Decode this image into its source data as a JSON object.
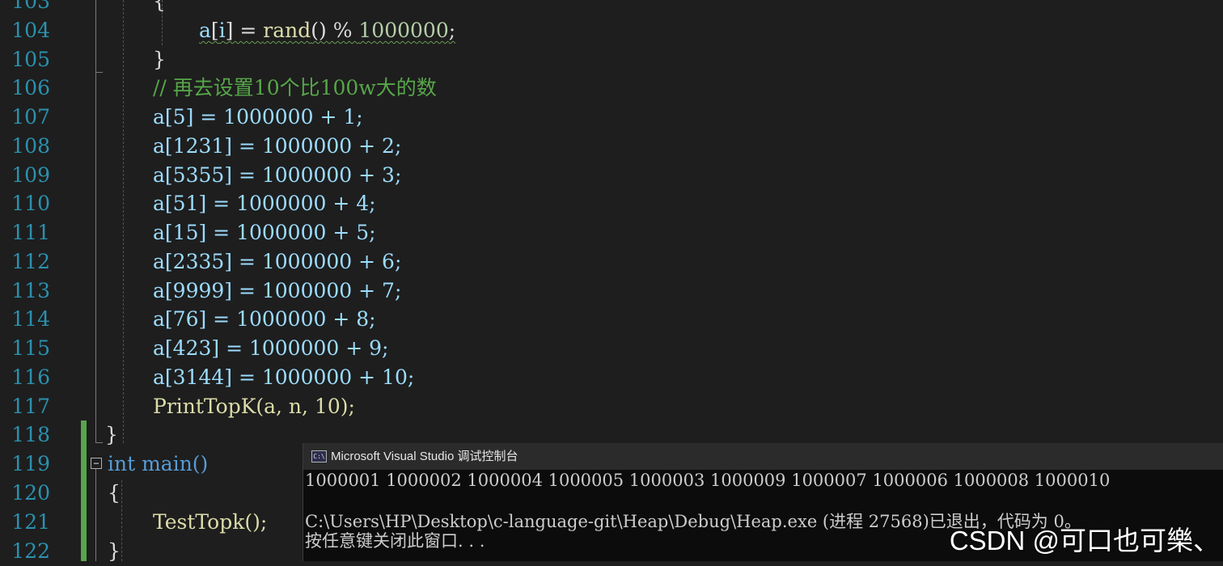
{
  "editor": {
    "lines": [
      {
        "num": "103",
        "text": "{"
      },
      {
        "num": "104",
        "text": "a[i] = rand() % 1000000;"
      },
      {
        "num": "105",
        "text": "}"
      },
      {
        "num": "106",
        "text": "// 再去设置10个比100w大的数"
      },
      {
        "num": "107",
        "text": "a[5] = 1000000 + 1;"
      },
      {
        "num": "108",
        "text": "a[1231] = 1000000 + 2;"
      },
      {
        "num": "109",
        "text": "a[5355] = 1000000 + 3;"
      },
      {
        "num": "110",
        "text": "a[51] = 1000000 + 4;"
      },
      {
        "num": "111",
        "text": "a[15] = 1000000 + 5;"
      },
      {
        "num": "112",
        "text": "a[2335] = 1000000 + 6;"
      },
      {
        "num": "113",
        "text": "a[9999] = 1000000 + 7;"
      },
      {
        "num": "114",
        "text": "a[76] = 1000000 + 8;"
      },
      {
        "num": "115",
        "text": "a[423] = 1000000 + 9;"
      },
      {
        "num": "116",
        "text": "a[3144] = 1000000 + 10;"
      },
      {
        "num": "117",
        "text": "PrintTopK(a, n, 10);"
      },
      {
        "num": "118",
        "text": "}"
      },
      {
        "num": "119",
        "text": "int main()"
      },
      {
        "num": "120",
        "text": "{"
      },
      {
        "num": "121",
        "text": "TestTopk();"
      },
      {
        "num": "122",
        "text": "}"
      }
    ]
  },
  "console": {
    "title": "Microsoft Visual Studio 调试控制台",
    "icon": "console-app-icon",
    "output_line": "1000001 1000002 1000004 1000005 1000003 1000009 1000007 1000006 1000008 1000010",
    "exit_line": "C:\\Users\\HP\\Desktop\\c-language-git\\Heap\\Debug\\Heap.exe (进程 27568)已退出，代码为 0。",
    "prompt_line": "按任意键关闭此窗口. . ."
  },
  "watermark": "CSDN @可口也可樂、",
  "colors": {
    "background": "#1e1e1e",
    "line_number": "#2b91af",
    "comment": "#57a64a",
    "keyword": "#569cd6",
    "function": "#dcdcaa",
    "variable": "#9cdcfe",
    "number": "#b5cea8",
    "change_bar": "#57a64a"
  }
}
